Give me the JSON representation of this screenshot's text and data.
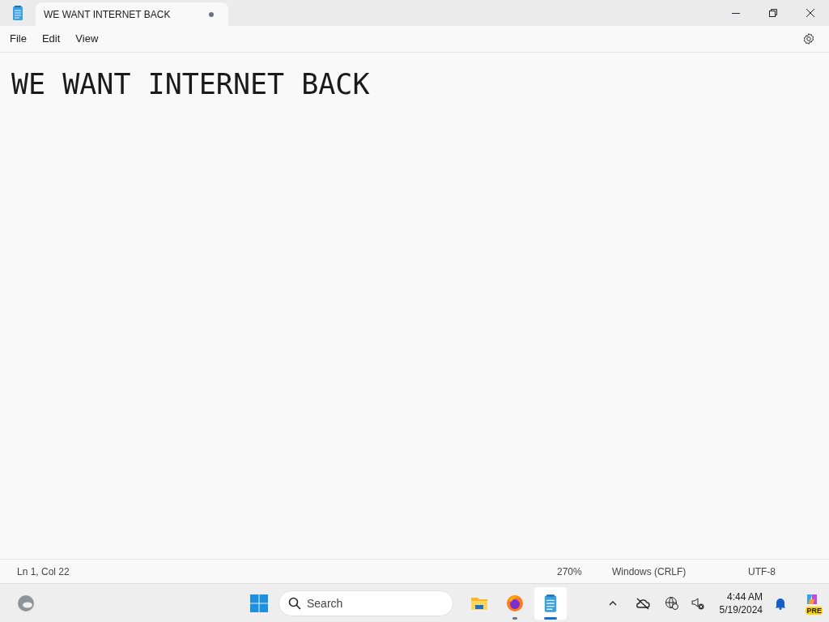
{
  "tab": {
    "title": "WE WANT INTERNET BACK",
    "unsaved": true
  },
  "menu": [
    "File",
    "Edit",
    "View"
  ],
  "editor": {
    "text": "WE WANT INTERNET BACK"
  },
  "status_bar": {
    "position": "Ln 1, Col 22",
    "zoom": "270%",
    "line_ending": "Windows (CRLF)",
    "encoding": "UTF-8"
  },
  "taskbar": {
    "search_placeholder": "Search",
    "apps": [
      {
        "kind": "folder",
        "running": false,
        "selected": false
      },
      {
        "kind": "browser",
        "running": true,
        "selected": false
      },
      {
        "kind": "notepad",
        "running": true,
        "selected": true
      }
    ],
    "time": "4:44 AM",
    "date": "5/19/2024",
    "copilot_badge": "PRE"
  }
}
